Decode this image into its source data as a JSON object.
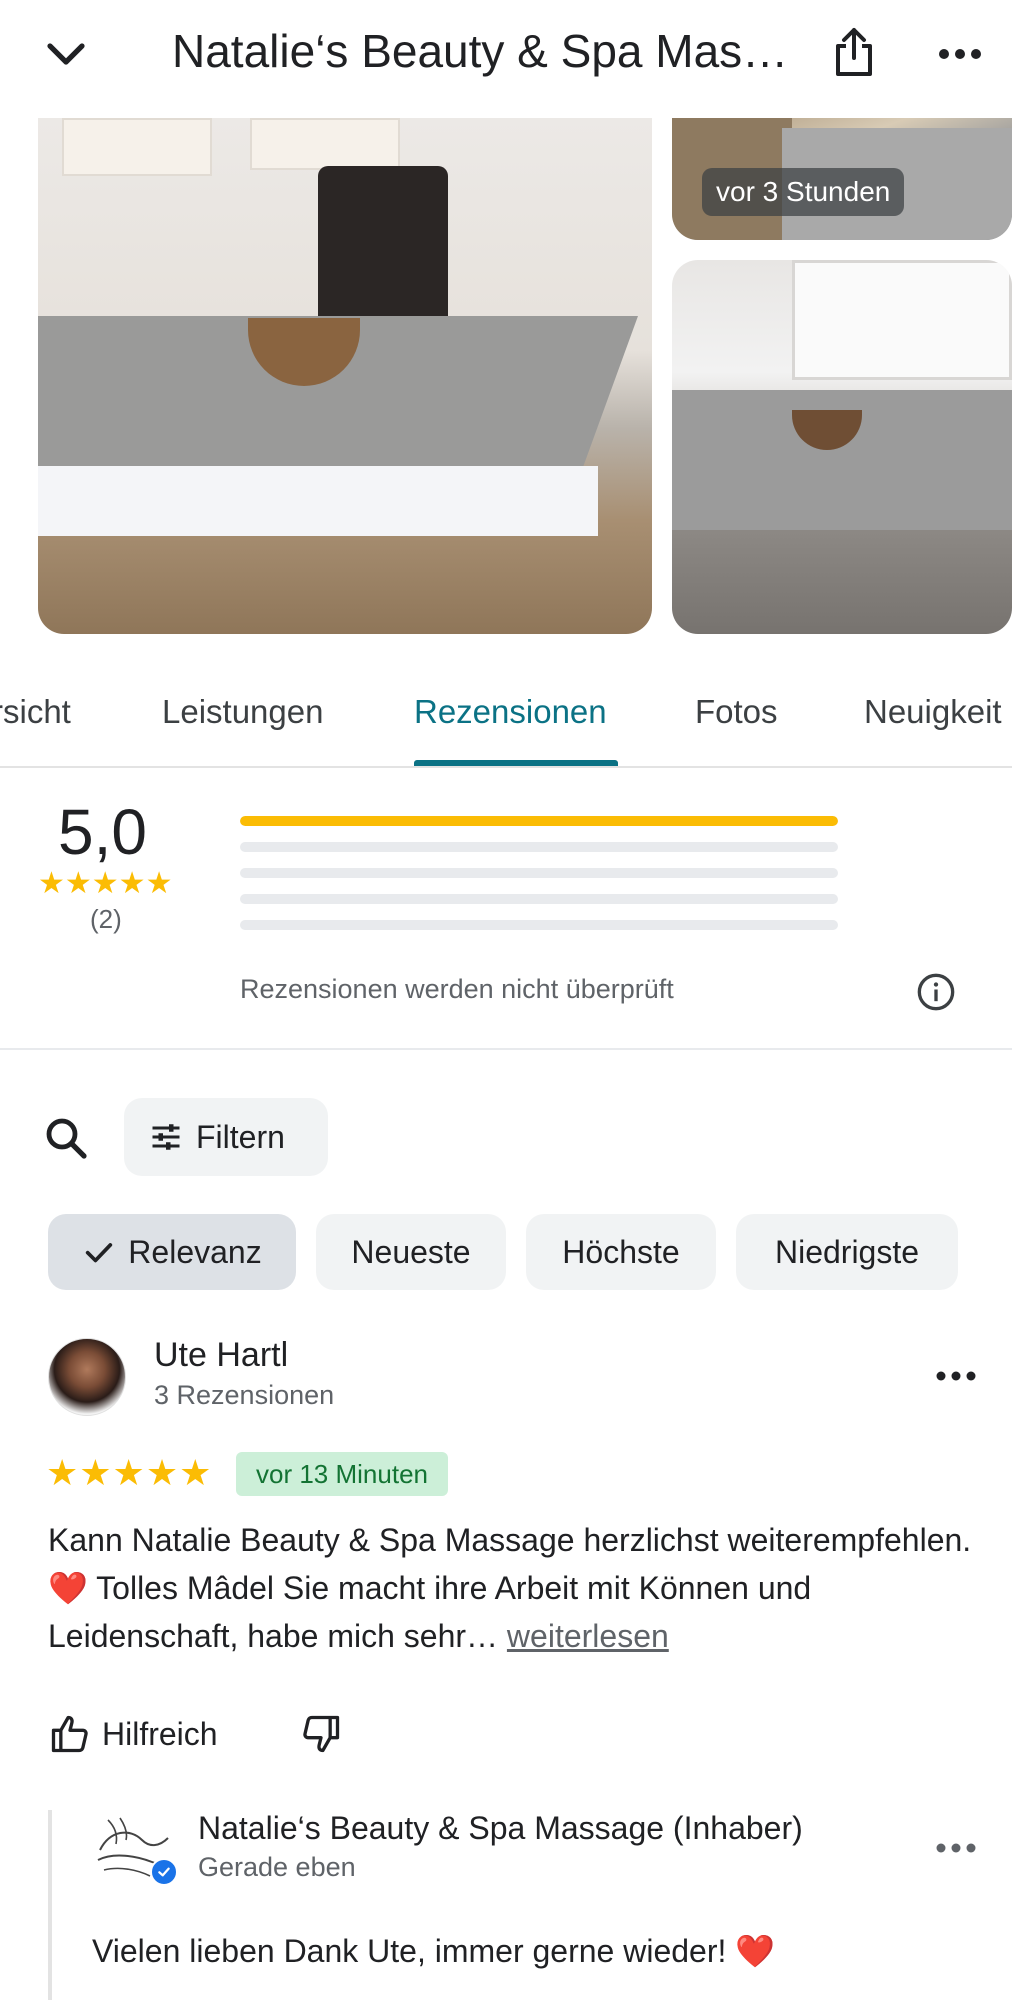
{
  "header": {
    "title": "Natalie‘s Beauty & Spa Mas…",
    "icons": {
      "back": "chevron-down-icon",
      "share": "share-icon",
      "more": "more-horiz-icon"
    }
  },
  "photos": {
    "badge_text": "vor 3 Stunden"
  },
  "tabs": [
    {
      "label": "rsicht"
    },
    {
      "label": "Leistungen"
    },
    {
      "label": "Rezensionen",
      "active": true
    },
    {
      "label": "Fotos"
    },
    {
      "label": "Neuigkeit"
    }
  ],
  "rating": {
    "value": "5,0",
    "stars": "★★★★★",
    "count": "(2)",
    "distribution": [
      {
        "stars": 5,
        "fraction": 1.0
      },
      {
        "stars": 4,
        "fraction": 0.0
      },
      {
        "stars": 3,
        "fraction": 0.0
      },
      {
        "stars": 2,
        "fraction": 0.0
      },
      {
        "stars": 1,
        "fraction": 0.0
      }
    ],
    "note": "Rezensionen werden nicht überprüft"
  },
  "toolbar": {
    "filter_label": "Filtern"
  },
  "sort_chips": [
    {
      "label": "Relevanz",
      "selected": true
    },
    {
      "label": "Neueste"
    },
    {
      "label": "Höchste"
    },
    {
      "label": "Niedrigste"
    }
  ],
  "review": {
    "author": "Ute Hartl",
    "meta": "3 Rezensionen",
    "stars": "★★★★★",
    "time_badge": "vor 13 Minuten",
    "text_part1": "Kann Natalie Beauty & Spa Massage herzlichst weiterempfehlen.",
    "heart": "❤️",
    "text_part2": " Tolles Mâdel Sie macht ihre Arbeit mit Können und Leidenschaft, habe mich sehr… ",
    "read_more": "weiterlesen",
    "helpful_label": "Hilfreich"
  },
  "owner_reply": {
    "name": "Natalie‘s Beauty & Spa Massage (Inhaber)",
    "time": "Gerade eben",
    "text": "Vielen lieben Dank Ute, immer gerne wieder! ",
    "heart": "❤️"
  },
  "colors": {
    "accent": "#0b7285",
    "star": "#fbbc04",
    "badge_bg": "#ccefd8",
    "badge_text": "#137333",
    "verified": "#1a73e8"
  }
}
